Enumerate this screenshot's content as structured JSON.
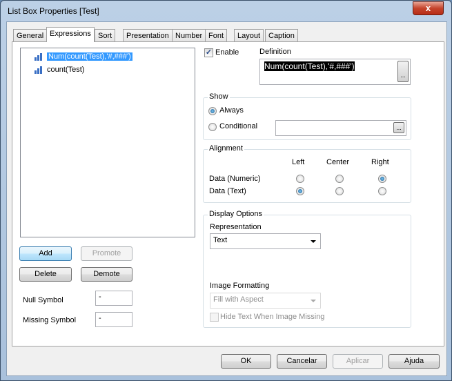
{
  "window": {
    "title": "List Box Properties [Test]",
    "close": "x"
  },
  "tabs": [
    "General",
    "Expressions",
    "Sort",
    "Presentation",
    "Number",
    "Font",
    "Layout",
    "Caption"
  ],
  "expressions": {
    "items": [
      "Num(count(Test),'#,###')",
      "count(Test)"
    ],
    "selected": 0
  },
  "buttons": {
    "add": "Add",
    "promote": "Promote",
    "delete": "Delete",
    "demote": "Demote"
  },
  "symbols": {
    "null_label": "Null Symbol",
    "null_value": "-",
    "missing_label": "Missing Symbol",
    "missing_value": "-"
  },
  "enable": {
    "label": "Enable",
    "checked": true
  },
  "definition": {
    "label": "Definition",
    "value": "Num(count(Test),'#,###')",
    "ellipsis": "..."
  },
  "show": {
    "caption": "Show",
    "always": "Always",
    "conditional": "Conditional",
    "selected": "Always",
    "ellipsis": "..."
  },
  "alignment": {
    "caption": "Alignment",
    "columns": [
      "Left",
      "Center",
      "Right"
    ],
    "rows": [
      {
        "label": "Data (Numeric)",
        "value": "Right"
      },
      {
        "label": "Data (Text)",
        "value": "Left"
      }
    ]
  },
  "display": {
    "caption": "Display Options",
    "representation_label": "Representation",
    "representation_value": "Text",
    "image_formatting_label": "Image Formatting",
    "image_formatting_value": "Fill with Aspect",
    "hide_text_label": "Hide Text When Image Missing"
  },
  "footer": {
    "ok": "OK",
    "cancel": "Cancelar",
    "apply": "Aplicar",
    "help": "Ajuda"
  }
}
